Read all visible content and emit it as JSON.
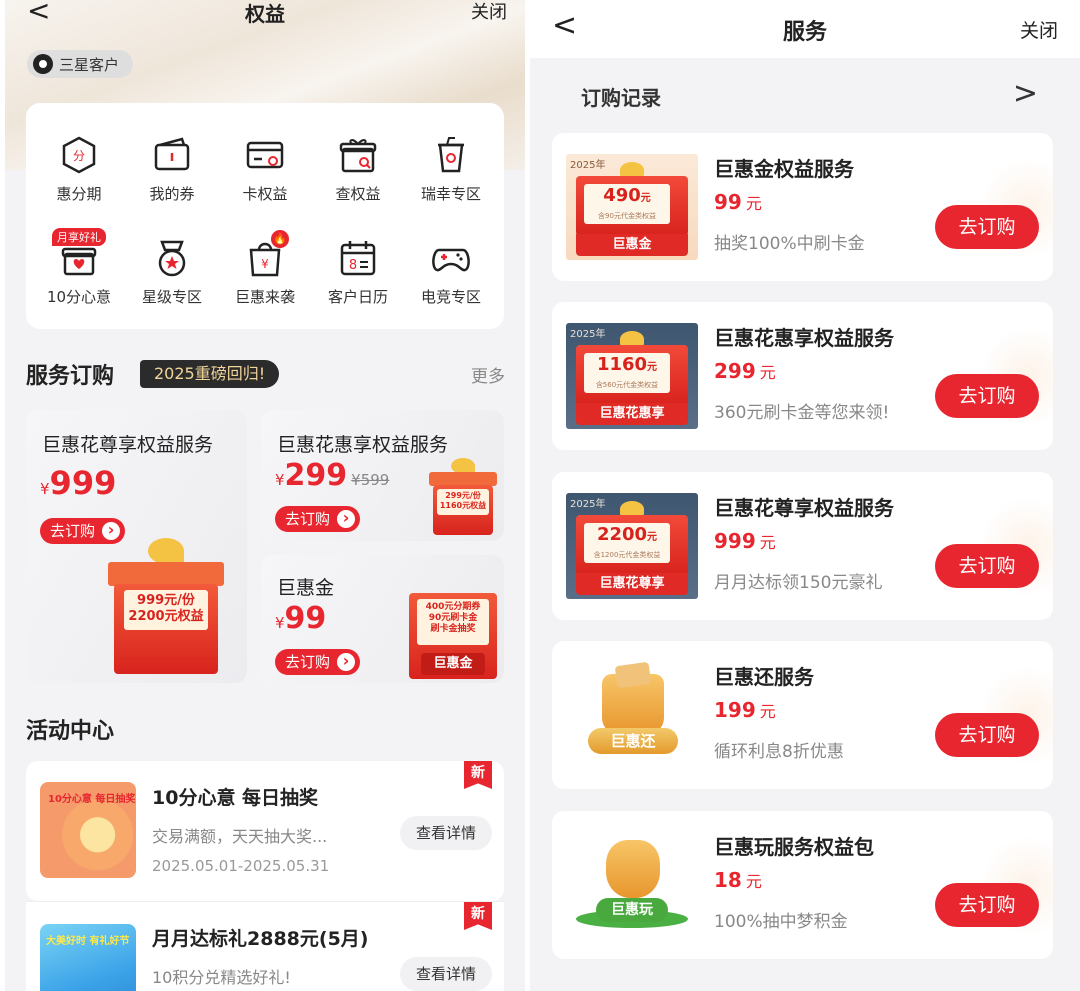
{
  "left": {
    "nav": {
      "back_glyph": "<",
      "title": "权益",
      "close": "关闭"
    },
    "tier": {
      "icon": "shield-icon",
      "label": "三星客户"
    },
    "grid": [
      {
        "label": "惠分期",
        "icon": "installment-icon",
        "glyph": "分"
      },
      {
        "label": "我的券",
        "icon": "coupon-icon",
        "glyph": "▭"
      },
      {
        "label": "卡权益",
        "icon": "card-icon",
        "glyph": "▭"
      },
      {
        "label": "查权益",
        "icon": "gift-search-icon",
        "glyph": "⌕"
      },
      {
        "label": "瑞幸专区",
        "icon": "cup-icon",
        "glyph": "☕"
      },
      {
        "label": "10分心意",
        "icon": "gift-box-icon",
        "glyph": "♥",
        "badge": "月享好礼"
      },
      {
        "label": "星级专区",
        "icon": "star-medal-icon",
        "glyph": "✪"
      },
      {
        "label": "巨惠来袭",
        "icon": "shopping-bag-icon",
        "glyph": "¥"
      },
      {
        "label": "客户日历",
        "icon": "calendar-icon",
        "glyph": "8"
      },
      {
        "label": "电竞专区",
        "icon": "gamepad-icon",
        "glyph": "🎮"
      }
    ],
    "service_section": {
      "title": "服务订购",
      "badge": "2025重磅回归!",
      "more": "更多"
    },
    "products": [
      {
        "title": "巨惠花尊享权益服务",
        "currency": "¥",
        "price": "999",
        "cta": "去订购",
        "gift_line1": "999元/份",
        "gift_line2": "2200元权益"
      },
      {
        "title": "巨惠花惠享权益服务",
        "currency": "¥",
        "price": "299",
        "orig": "¥599",
        "cta": "去订购",
        "gift_line1": "299元/份",
        "gift_line2": "1160元权益"
      },
      {
        "title": "巨惠金",
        "currency": "¥",
        "price": "99",
        "cta": "去订购",
        "gift_line1": "400元分期券",
        "gift_line2": "90元刷卡金",
        "gift_line3": "刷卡金抽奖",
        "gift_footer": "巨惠金"
      }
    ],
    "activity_section": {
      "title": "活动中心"
    },
    "activities": [
      {
        "title": "10分心意 每日抽奖",
        "desc": "交易满额，天天抽大奖...",
        "date": "2025.05.01-2025.05.31",
        "btn": "查看详情",
        "tag": "新",
        "thumb_text": "10分心意 每日抽奖"
      },
      {
        "title": "月月达标礼2888元(5月)",
        "desc": "10积分兑精选好礼!",
        "btn": "查看详情",
        "tag": "新",
        "thumb_text": "大美好时 有礼好节 "
      }
    ]
  },
  "right": {
    "nav": {
      "back_glyph": "<",
      "title": "服务",
      "close": "关闭"
    },
    "record": {
      "label": "订购记录",
      "chevron": ">"
    },
    "services": [
      {
        "name": "巨惠金权益服务",
        "price": "99",
        "unit": "元",
        "desc": "抽奖100%中刷卡金",
        "btn": "去订购",
        "thumb": {
          "year": "2025年",
          "amount": "490",
          "amount_unit": "元",
          "sub": "含90元代金类权益",
          "footer": "巨惠金"
        }
      },
      {
        "name": "巨惠花惠享权益服务",
        "price": "299",
        "unit": "元",
        "desc": "360元刷卡金等您来领!",
        "btn": "去订购",
        "thumb": {
          "year": "2025年",
          "amount": "1160",
          "amount_unit": "元",
          "sub": "含560元代金类权益",
          "footer": "巨惠花惠享"
        }
      },
      {
        "name": "巨惠花尊享权益服务",
        "price": "999",
        "unit": "元",
        "desc": "月月达标领150元豪礼",
        "btn": "去订购",
        "thumb": {
          "year": "2025年",
          "amount": "2200",
          "amount_unit": "元",
          "sub": "含1200元代金类权益",
          "footer": "巨惠花尊享"
        }
      },
      {
        "name": "巨惠还服务",
        "price": "199",
        "unit": "元",
        "desc": "循环利息8折优惠",
        "btn": "去订购",
        "thumb": {
          "label": "巨惠还"
        }
      },
      {
        "name": "巨惠玩服务权益包",
        "price": "18",
        "unit": "元",
        "desc": "100%抽中梦积金",
        "btn": "去订购",
        "thumb": {
          "label": "巨惠玩"
        }
      }
    ]
  },
  "colors": {
    "accent": "#e8262f",
    "bg": "#f3f3f5",
    "dark_badge": "#2b2b2b",
    "gold_text": "#f1d49a"
  }
}
